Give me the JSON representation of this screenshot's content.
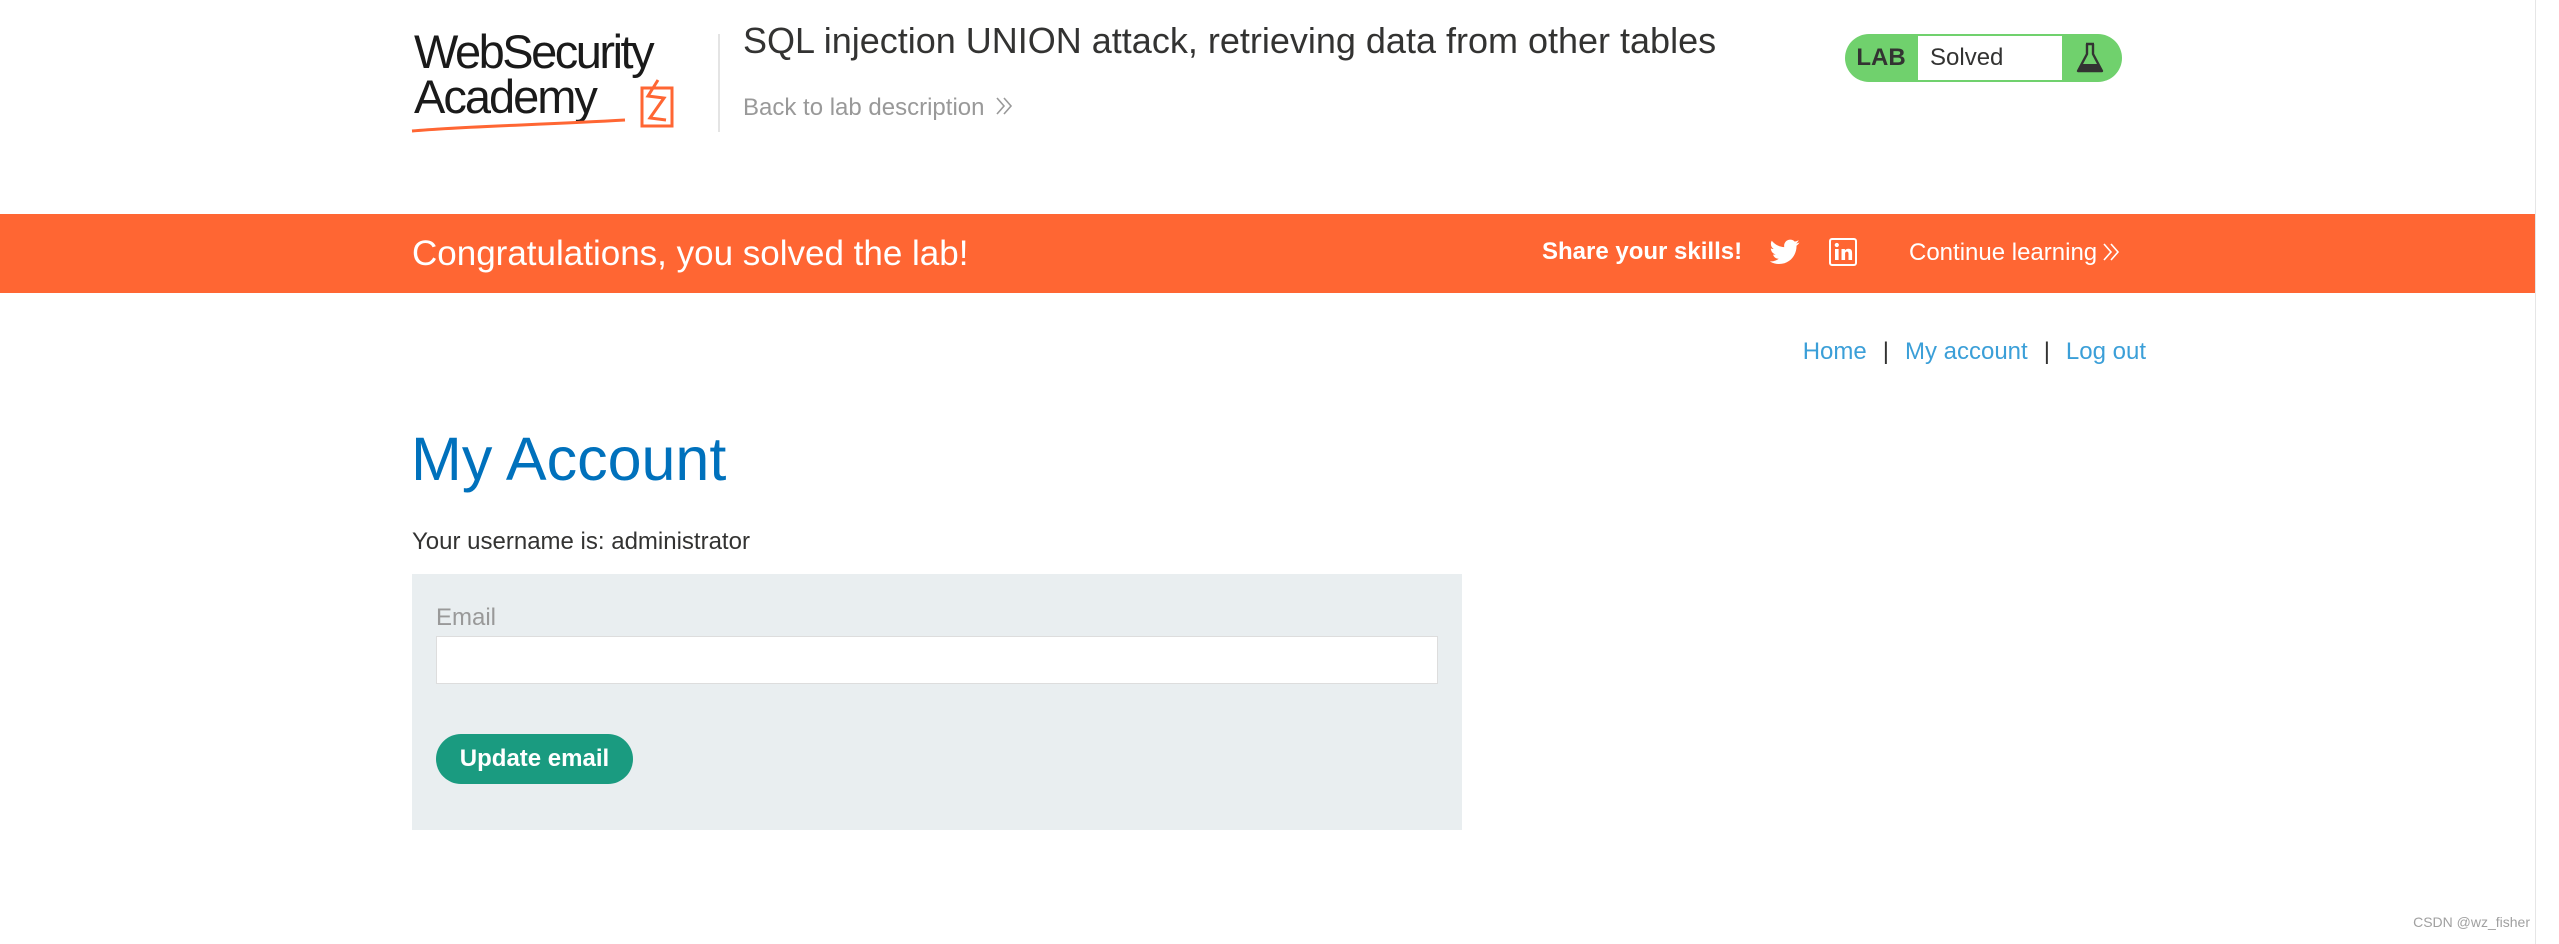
{
  "header": {
    "logo_line1": "WebSecurity",
    "logo_line2": "Academy",
    "lab_title": "SQL injection UNION attack, retrieving data from other tables",
    "back_link": "Back to lab description",
    "lab_badge": {
      "label": "LAB",
      "status": "Solved",
      "icon": "flask-icon",
      "color": "#70d16d"
    }
  },
  "banner": {
    "message": "Congratulations, you solved the lab!",
    "share_label": "Share your skills!",
    "share_icons": [
      "twitter-icon",
      "linkedin-icon"
    ],
    "continue_label": "Continue learning",
    "color": "#ff6633"
  },
  "nav": {
    "items": [
      {
        "label": "Home"
      },
      {
        "label": "My account"
      },
      {
        "label": "Log out"
      }
    ],
    "separator": "|"
  },
  "main": {
    "title": "My Account",
    "username_line": "Your username is: administrator",
    "email_form": {
      "label": "Email",
      "value": "",
      "placeholder": "",
      "button_label": "Update email",
      "button_color": "#1a9b80"
    }
  },
  "watermark": "CSDN @wz_fisher",
  "colors": {
    "accent_blue": "#0071bc",
    "link_blue": "#3b9fd8",
    "banner_orange": "#ff6633"
  }
}
